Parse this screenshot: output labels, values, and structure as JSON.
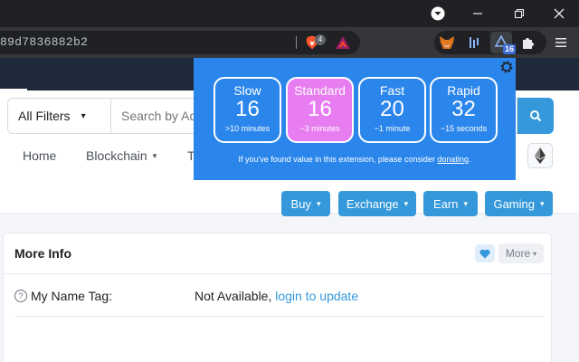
{
  "browser": {
    "url": "89d7836882b2",
    "brave_shield_count": "4",
    "gas_badge": "16",
    "window_controls": [
      "minimize-icon",
      "maximize-icon",
      "close-icon"
    ]
  },
  "gas_popup": {
    "tiers": [
      {
        "name": "Slow",
        "price": "16",
        "time": ">10 minutes",
        "selected": false
      },
      {
        "name": "Standard",
        "price": "16",
        "time": "~3 minutes",
        "selected": true
      },
      {
        "name": "Fast",
        "price": "20",
        "time": "~1 minute",
        "selected": false
      },
      {
        "name": "Rapid",
        "price": "32",
        "time": "~15 seconds",
        "selected": false
      }
    ],
    "note_prefix": "If you've found value in this extension, please consider ",
    "note_link": "donating",
    "note_suffix": ".",
    "colors": {
      "background": "#2b86ec",
      "selected": "#e77df0"
    }
  },
  "page": {
    "search": {
      "filter_label": "All Filters",
      "placeholder": "Search by Address / Txn Hash / Block / Token / Ens"
    },
    "nav": {
      "home": "Home",
      "blockchain": "Blockchain",
      "tokens_partial": "T"
    },
    "actions": {
      "buy": "Buy",
      "exchange": "Exchange",
      "earn": "Earn",
      "gaming": "Gaming"
    },
    "more_info": {
      "title": "More Info",
      "more_label": "More",
      "name_tag_label": "My Name Tag:",
      "name_tag_value": "Not Available,",
      "name_tag_link": "login to update"
    },
    "colors": {
      "accent": "#3498db",
      "header_dark": "#1e2a39"
    }
  }
}
